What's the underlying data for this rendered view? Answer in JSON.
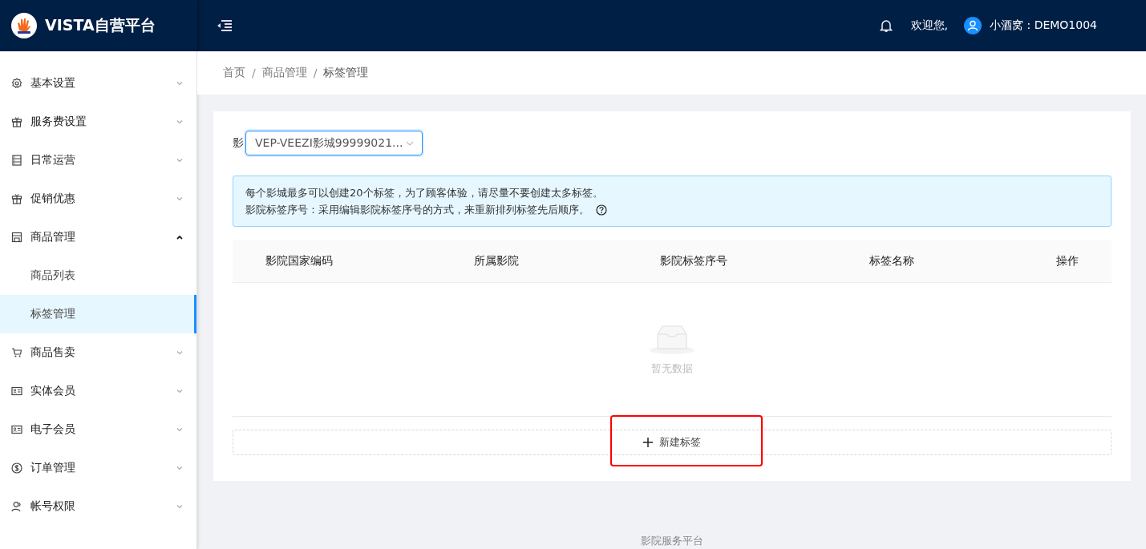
{
  "header": {
    "brand": "VISTA自营平台",
    "welcome": "欢迎您,",
    "user": "小酒窝 : DEMO1004"
  },
  "sidebar": {
    "items": [
      {
        "kind": "gear",
        "label": "基本设置",
        "expanded": false
      },
      {
        "kind": "gift",
        "label": "服务费设置",
        "expanded": false
      },
      {
        "kind": "list",
        "label": "日常运营",
        "expanded": false
      },
      {
        "kind": "gift",
        "label": "促销优惠",
        "expanded": false
      },
      {
        "kind": "store",
        "label": "商品管理",
        "expanded": true,
        "children": [
          {
            "label": "商品列表",
            "selected": false
          },
          {
            "label": "标签管理",
            "selected": true
          }
        ]
      },
      {
        "kind": "cart",
        "label": "商品售卖",
        "expanded": false
      },
      {
        "kind": "card",
        "label": "实体会员",
        "expanded": false
      },
      {
        "kind": "card",
        "label": "电子会员",
        "expanded": false
      },
      {
        "kind": "dollar",
        "label": "订单管理",
        "expanded": false
      },
      {
        "kind": "user",
        "label": "帐号权限",
        "expanded": false
      }
    ]
  },
  "breadcrumb": [
    {
      "kind": "link",
      "text": "首页"
    },
    {
      "kind": "separator",
      "text": "/"
    },
    {
      "kind": "link",
      "text": "商品管理"
    },
    {
      "kind": "separator",
      "text": "/"
    },
    {
      "kind": "current",
      "text": "标签管理"
    }
  ],
  "filter": {
    "label": "影",
    "value": "VEP-VEEZI影城99999021..."
  },
  "alert": {
    "lines": [
      "每个影城最多可以创建20个标签，为了顾客体验，请尽量不要创建太多标签。",
      "影院标签序号：采用编辑影院标签序号的方式，来重新排列标签先后顺序。"
    ]
  },
  "table": {
    "columns": [
      "影院国家编码",
      "所属影院",
      "影院标签序号",
      "标签名称",
      "操作"
    ],
    "empty_text": "暂无数据"
  },
  "add_button": {
    "label": "新建标签",
    "highlighted": true
  },
  "footer": "影院服务平台"
}
